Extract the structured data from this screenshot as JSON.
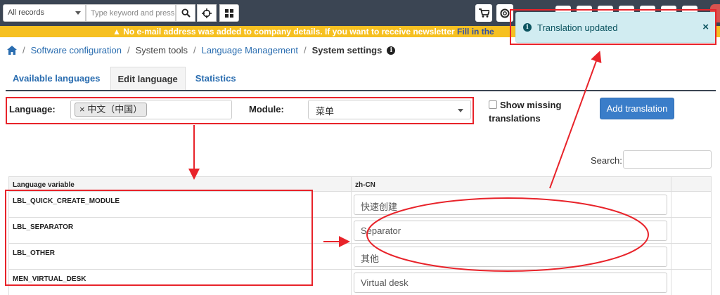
{
  "topbar": {
    "records_select": "All records",
    "search_placeholder": "Type keyword and press"
  },
  "notice": {
    "text": "No e-mail address was added to company details. If you want to receive newsletter",
    "link": "Fill in the"
  },
  "toast": {
    "message": "Translation updated",
    "close": "×"
  },
  "breadcrumb": {
    "items": [
      "Software configuration",
      "System tools",
      "Language Management",
      "System settings"
    ]
  },
  "tabs": [
    "Available languages",
    "Edit language",
    "Statistics"
  ],
  "filters": {
    "language_label": "Language:",
    "language_chip": "× 中文（中国）",
    "module_label": "Module:",
    "module_value": "菜单",
    "show_missing": "Show missing translations",
    "add_button": "Add translation",
    "search_label": "Search:"
  },
  "table": {
    "headers": [
      "Language variable",
      "zh-CN"
    ],
    "rows": [
      {
        "variable": "LBL_QUICK_CREATE_MODULE",
        "value": "快速创建"
      },
      {
        "variable": "LBL_SEPARATOR",
        "value": "Separator"
      },
      {
        "variable": "LBL_OTHER",
        "value": "其他"
      },
      {
        "variable": "MEN_VIRTUAL_DESK",
        "value": "Virtual desk"
      }
    ]
  },
  "colors": {
    "topbar": "#3b4553",
    "notice": "#f6c021",
    "toast_bg": "#d1ecf1",
    "annotation": "#e8232a",
    "primary": "#3a7dc9"
  }
}
